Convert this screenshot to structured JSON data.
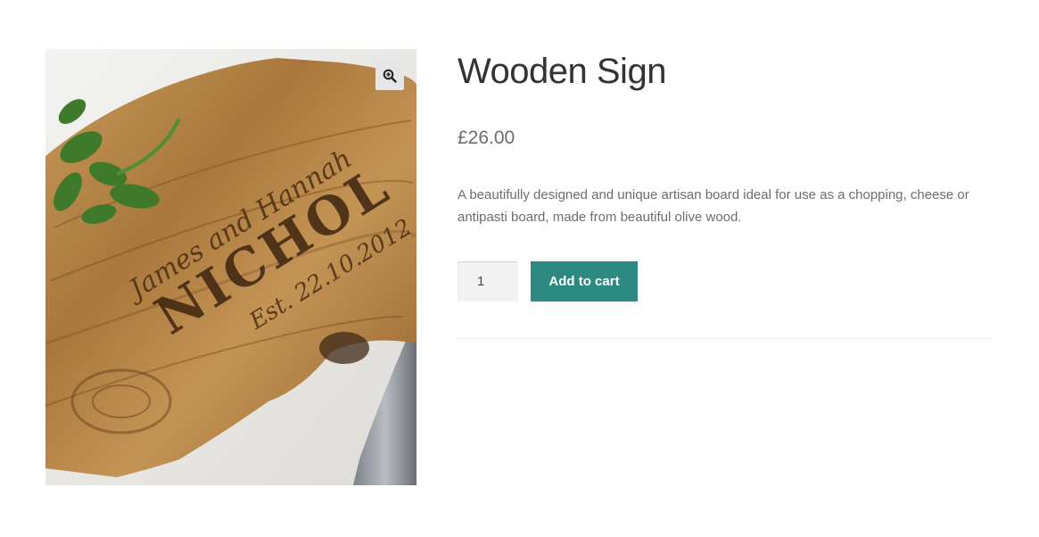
{
  "product": {
    "title": "Wooden Sign",
    "price": "£26.00",
    "description": "A beautifully designed and unique artisan board ideal for use as a chopping, cheese or antipasti board, made from beautiful olive wood.",
    "quantity": "1",
    "add_to_cart_label": "Add to cart"
  },
  "gallery": {
    "board_script_text": "James and Hannah",
    "board_surname": "NICHOL",
    "board_est_text": "Est. 22.10.2012",
    "zoom_icon": "magnifier-plus-icon"
  },
  "colors": {
    "accent": "#2c8a83",
    "title": "#333333",
    "body_text": "#6d6d6d"
  }
}
